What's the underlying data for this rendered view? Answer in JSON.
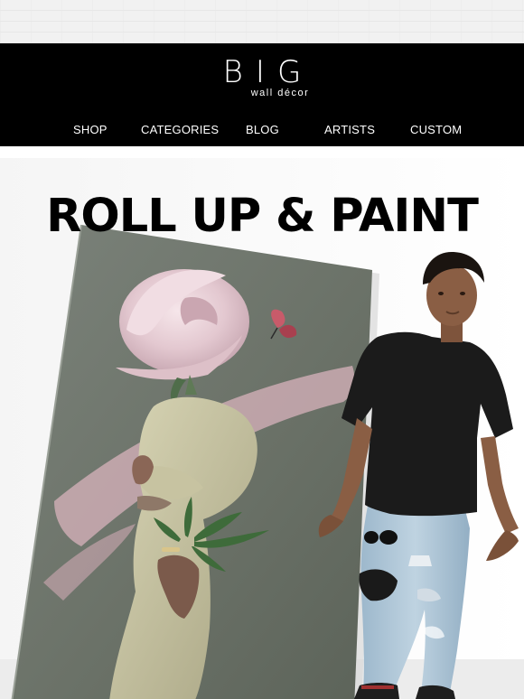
{
  "brand": {
    "name": "BIG",
    "tagline": "wall décor"
  },
  "nav": {
    "items": [
      {
        "label": "SHOP"
      },
      {
        "label": "CATEGORIES"
      },
      {
        "label": "BLOG"
      },
      {
        "label": "ARTISTS"
      },
      {
        "label": "CUSTOM"
      }
    ]
  },
  "hero": {
    "title": "ROLL UP & PAINT",
    "image": "canvas-print-rose-woman-with-model"
  },
  "colors": {
    "header_bg": "#000000",
    "nav_text": "#ffffff",
    "canvas_bg": "#6d746b",
    "rose": "#e6cdd4",
    "shirt": "#1b1b1b",
    "jeans": "#a9c3d6"
  }
}
